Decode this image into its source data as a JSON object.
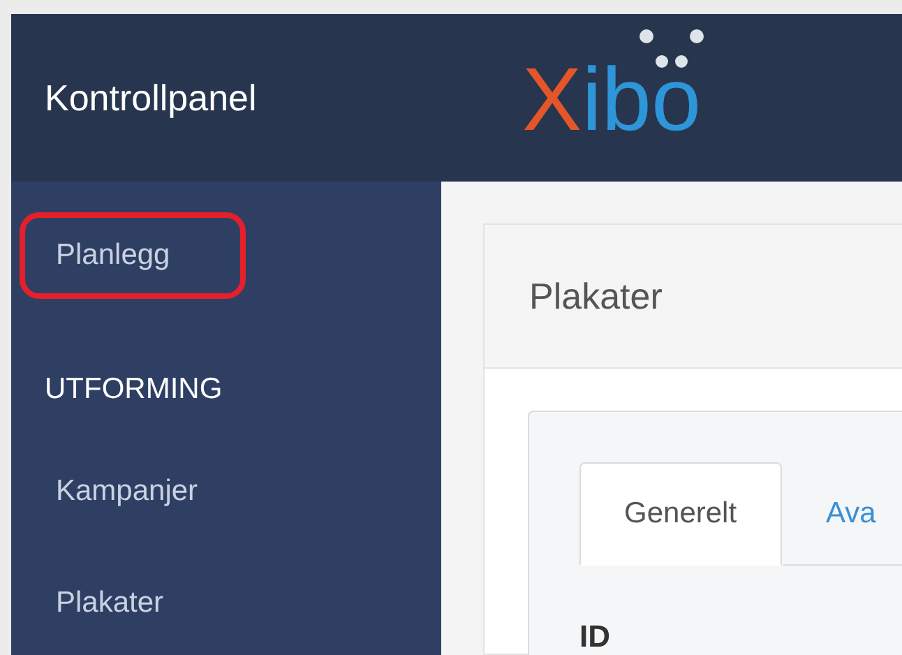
{
  "sidebar": {
    "title": "Kontrollpanel",
    "items": [
      {
        "kind": "link",
        "label": "Planlegg",
        "highlighted": true
      },
      {
        "kind": "heading",
        "label": "UTFORMING",
        "highlighted": false
      },
      {
        "kind": "link",
        "label": "Kampanjer",
        "highlighted": false
      },
      {
        "kind": "link",
        "label": "Plakater",
        "highlighted": false
      }
    ]
  },
  "logo": {
    "text": "Xibo"
  },
  "panel": {
    "title": "Plakater",
    "tabs": [
      {
        "label": "Generelt",
        "selected": true
      },
      {
        "label": "Ava",
        "selected": false
      }
    ],
    "field_label": "ID"
  }
}
